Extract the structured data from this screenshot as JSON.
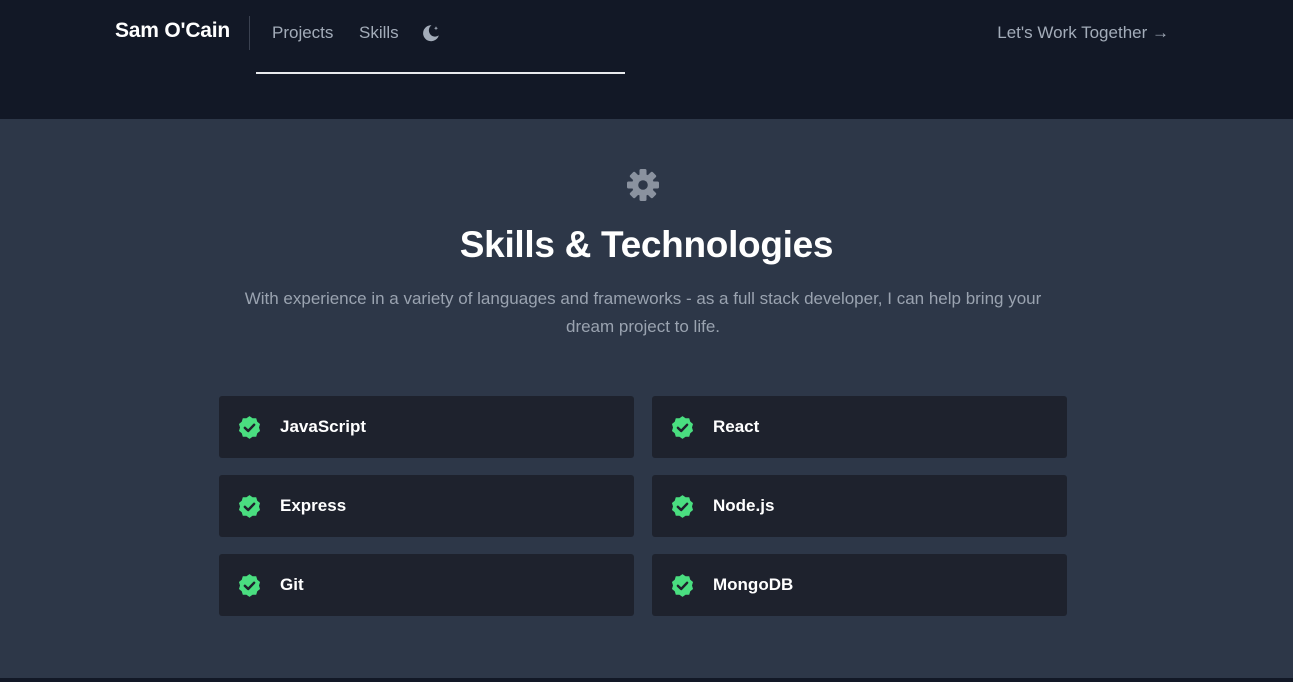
{
  "header": {
    "brand": "Sam O'Cain",
    "nav": {
      "projects": "Projects",
      "skills": "Skills"
    },
    "theme_toggle_icon": "moon-icon",
    "cta": "Let's Work Together →"
  },
  "section": {
    "icon": "gear-icon",
    "title": "Skills & Technologies",
    "subtitle": "With experience in a variety of languages and frameworks - as a full stack developer, I can help bring your dream project to life."
  },
  "skills": [
    "JavaScript",
    "React",
    "Express",
    "Node.js",
    "Git",
    "MongoDB"
  ],
  "colors": {
    "header_bg": "#121826",
    "section_bg": "#2d3748",
    "card_bg": "#1e222d",
    "check_green": "#4ade80",
    "muted_text": "#9aa3b0"
  }
}
